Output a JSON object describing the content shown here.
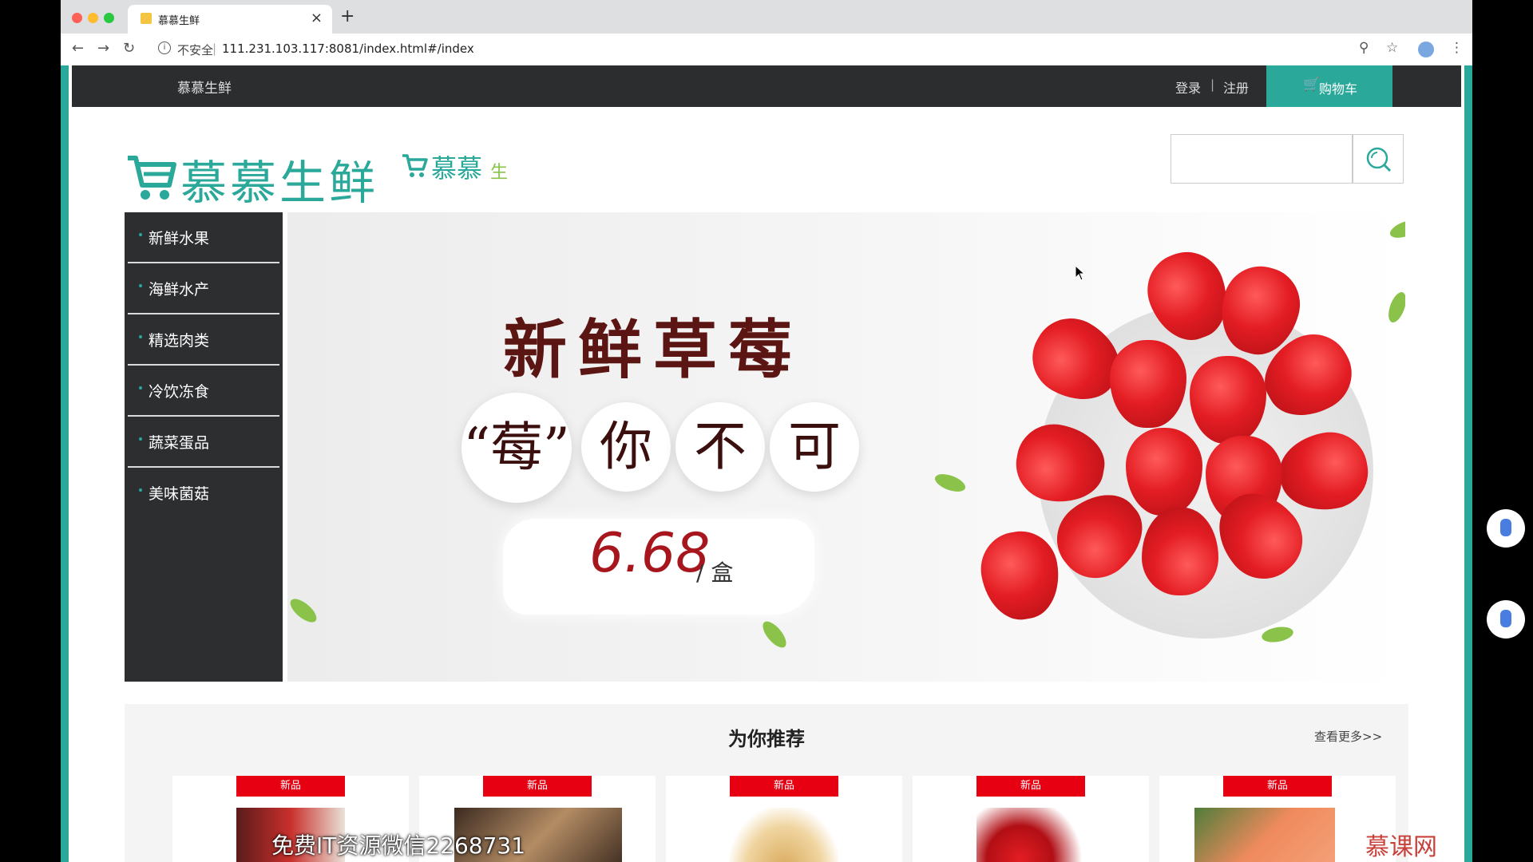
{
  "browser": {
    "tab_title": "慕慕生鲜",
    "insecure_label": "不安全",
    "url": "111.231.103.117:8081/index.html#/index",
    "new_tab": "+",
    "close_tab": "×"
  },
  "topbar": {
    "brand": "慕慕生鲜",
    "login": "登录",
    "separator": "|",
    "register": "注册",
    "cart": "购物车"
  },
  "logo": {
    "text": "慕慕生鲜",
    "secondary_text": "慕慕",
    "secondary_tail": "生"
  },
  "search": {
    "placeholder": ""
  },
  "sidebar": {
    "items": [
      {
        "label": "新鲜水果"
      },
      {
        "label": "海鲜水产"
      },
      {
        "label": "精选肉类"
      },
      {
        "label": "冷饮冻食"
      },
      {
        "label": "蔬菜蛋品"
      },
      {
        "label": "美味菌菇"
      }
    ]
  },
  "banner": {
    "title": "新鲜草莓",
    "slogan": [
      "“莓”",
      "你",
      "不",
      "可"
    ],
    "price": "6.68",
    "unit": "/ 盒"
  },
  "recommend": {
    "title": "为你推荐",
    "more": "查看更多>>",
    "products": [
      {
        "badge": "新品"
      },
      {
        "badge": "新品"
      },
      {
        "badge": "新品"
      },
      {
        "badge": "新品"
      },
      {
        "badge": "新品"
      }
    ]
  },
  "overlay": {
    "watermark": "免费IT资源微信2268731",
    "mooc_logo": "慕课网"
  },
  "colors": {
    "accent": "#2aa89a",
    "topbar": "#2c2d2f",
    "badge": "#e60012",
    "price": "#a8161d"
  }
}
